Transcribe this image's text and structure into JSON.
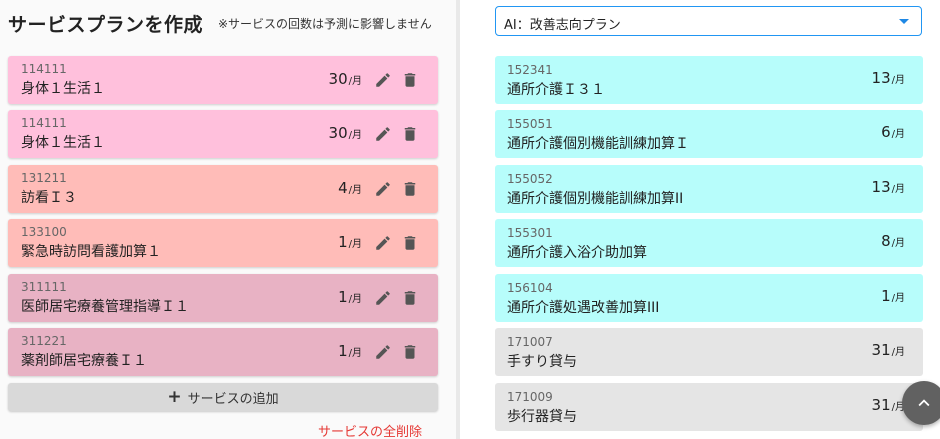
{
  "header": {
    "title": "サービスプランを作成",
    "note": "※サービスの回数は予測に影響しません"
  },
  "colors": {
    "pink": "#ffc0dc",
    "salmon": "#ffbcb8",
    "mauve": "#e8b2c4",
    "cyan": "#b7fdfb",
    "gray": "#e5e5e5"
  },
  "plan_items": [
    {
      "code": "114111",
      "name": "身体１生活１",
      "count": "30",
      "unit": "/月",
      "color": "#ffc0dc"
    },
    {
      "code": "114111",
      "name": "身体１生活１",
      "count": "30",
      "unit": "/月",
      "color": "#ffc0dc"
    },
    {
      "code": "131211",
      "name": "訪看Ｉ３",
      "count": "4",
      "unit": "/月",
      "color": "#ffbcb8"
    },
    {
      "code": "133100",
      "name": "緊急時訪問看護加算１",
      "count": "1",
      "unit": "/月",
      "color": "#ffbcb8"
    },
    {
      "code": "311111",
      "name": "医師居宅療養管理指導Ｉ１",
      "count": "1",
      "unit": "/月",
      "color": "#e8b2c4"
    },
    {
      "code": "311221",
      "name": "薬剤師居宅療養Ｉ１",
      "count": "1",
      "unit": "/月",
      "color": "#e8b2c4"
    }
  ],
  "actions": {
    "add_label": "サービスの追加",
    "delete_all_label": "サービスの全削除"
  },
  "ai_select": {
    "value": "AI：改善志向プラン"
  },
  "ai_items": [
    {
      "code": "152341",
      "name": "通所介護Ｉ３１",
      "count": "13",
      "unit": "/月",
      "color": "#b7fdfb"
    },
    {
      "code": "155051",
      "name": "通所介護個別機能訓練加算Ｉ",
      "count": "6",
      "unit": "/月",
      "color": "#b7fdfb"
    },
    {
      "code": "155052",
      "name": "通所介護個別機能訓練加算II",
      "count": "13",
      "unit": "/月",
      "color": "#b7fdfb"
    },
    {
      "code": "155301",
      "name": "通所介護入浴介助加算",
      "count": "8",
      "unit": "/月",
      "color": "#b7fdfb"
    },
    {
      "code": "156104",
      "name": "通所介護処遇改善加算III",
      "count": "1",
      "unit": "/月",
      "color": "#b7fdfb"
    },
    {
      "code": "171007",
      "name": "手すり貸与",
      "count": "31",
      "unit": "/月",
      "color": "#e5e5e5"
    },
    {
      "code": "171009",
      "name": "歩行器貸与",
      "count": "31",
      "unit": "/月",
      "color": "#e5e5e5"
    }
  ]
}
